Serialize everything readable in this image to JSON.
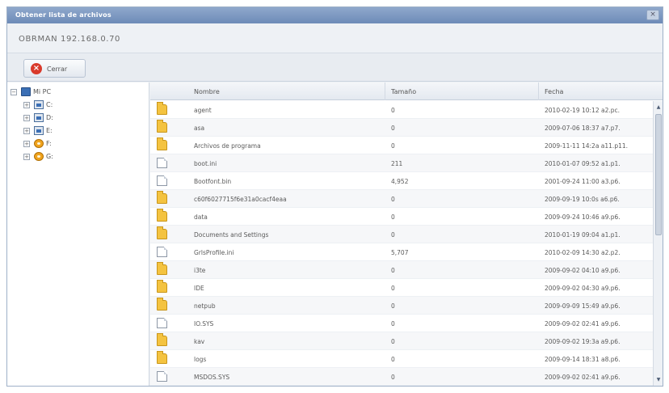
{
  "window": {
    "title": "Obtener lista de archivos",
    "close_label": "×"
  },
  "host": "OBRMAN 192.168.0.70",
  "toolbar": {
    "close_label": "Cerrar"
  },
  "tree": {
    "root": "Mi PC",
    "drives": [
      {
        "label": "C:",
        "icon": "hard-drive-icon"
      },
      {
        "label": "D:",
        "icon": "hard-drive-icon"
      },
      {
        "label": "E:",
        "icon": "hard-drive-icon"
      },
      {
        "label": "F:",
        "icon": "cd-drive-icon"
      },
      {
        "label": "G:",
        "icon": "cd-drive-icon"
      }
    ]
  },
  "grid": {
    "columns": {
      "name": "Nombre",
      "size": "Tamaño",
      "date": "Fecha"
    },
    "rows": [
      {
        "type": "folder",
        "name": "agent",
        "size": "0",
        "date": "2010-02-19 10:12 a2.pc."
      },
      {
        "type": "folder",
        "name": "asa",
        "size": "0",
        "date": "2009-07-06 18:37 a7.p7."
      },
      {
        "type": "folder",
        "name": "Archivos de programa",
        "size": "0",
        "date": "2009-11-11 14:2a a11.p11."
      },
      {
        "type": "file",
        "name": "boot.ini",
        "size": "211",
        "date": "2010-01-07 09:52 a1.p1."
      },
      {
        "type": "file",
        "name": "Bootfont.bin",
        "size": "4,952",
        "date": "2001-09-24 11:00 a3.p6."
      },
      {
        "type": "folder",
        "name": "c60f6027715f6e31a0cacf4eaa",
        "size": "0",
        "date": "2009-09-19 10:0s a6.p6."
      },
      {
        "type": "folder",
        "name": "data",
        "size": "0",
        "date": "2009-09-24 10:46 a9.p6."
      },
      {
        "type": "folder",
        "name": "Documents and Settings",
        "size": "0",
        "date": "2010-01-19 09:04 a1.p1."
      },
      {
        "type": "file",
        "name": "GrlsProfile.ini",
        "size": "5,707",
        "date": "2010-02-09 14:30 a2.p2."
      },
      {
        "type": "folder",
        "name": "i3te",
        "size": "0",
        "date": "2009-09-02 04:10 a9.p6."
      },
      {
        "type": "folder",
        "name": "IDE",
        "size": "0",
        "date": "2009-09-02 04:30 a9.p6."
      },
      {
        "type": "folder",
        "name": "netpub",
        "size": "0",
        "date": "2009-09-09 15:49 a9.p6."
      },
      {
        "type": "file",
        "name": "IO.SYS",
        "size": "0",
        "date": "2009-09-02 02:41 a9.p6."
      },
      {
        "type": "folder",
        "name": "kav",
        "size": "0",
        "date": "2009-09-02 19:3a a9.p6."
      },
      {
        "type": "folder",
        "name": "logs",
        "size": "0",
        "date": "2009-09-14 18:31 a8.p6."
      },
      {
        "type": "file",
        "name": "MSDOS.SYS",
        "size": "0",
        "date": "2009-09-02 02:41 a9.p6."
      }
    ]
  },
  "scrollbar": {
    "up_label": "▲",
    "down_label": "▼"
  }
}
